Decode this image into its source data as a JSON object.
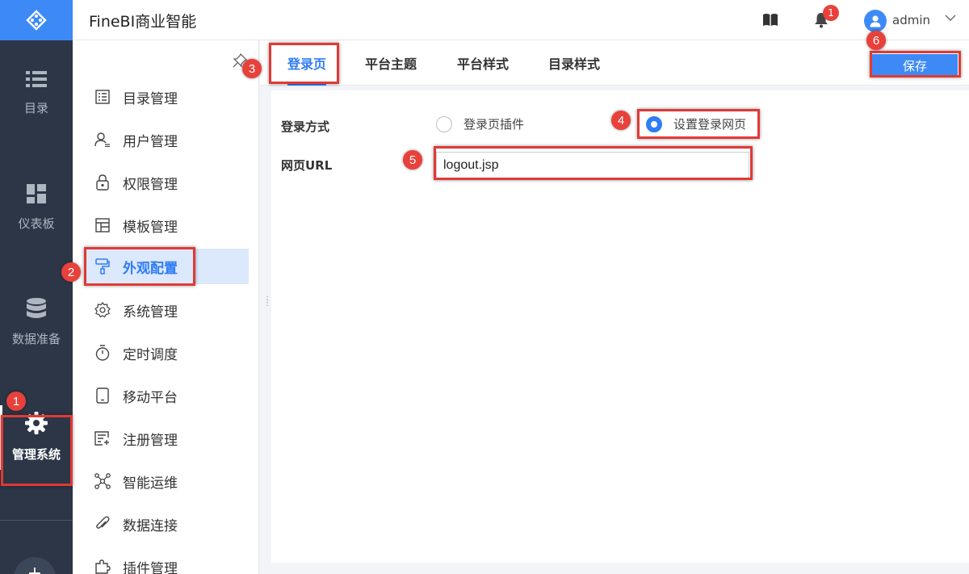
{
  "app": {
    "title": "FineBI商业智能"
  },
  "header": {
    "notification_count": "1",
    "username": "admin"
  },
  "rail": {
    "items": [
      {
        "label": "目录",
        "icon": "list-icon"
      },
      {
        "label": "仪表板",
        "icon": "dashboard-icon"
      },
      {
        "label": "数据准备",
        "icon": "database-icon"
      },
      {
        "label": "管理系统",
        "icon": "gear-icon",
        "active": true
      }
    ]
  },
  "menu": {
    "items": [
      {
        "label": "目录管理",
        "icon": "catalog-icon"
      },
      {
        "label": "用户管理",
        "icon": "user-icon"
      },
      {
        "label": "权限管理",
        "icon": "lock-icon"
      },
      {
        "label": "模板管理",
        "icon": "template-icon"
      },
      {
        "label": "外观配置",
        "icon": "paint-roller-icon",
        "active": true
      },
      {
        "label": "系统管理",
        "icon": "settings-icon"
      },
      {
        "label": "定时调度",
        "icon": "timer-icon"
      },
      {
        "label": "移动平台",
        "icon": "mobile-icon"
      },
      {
        "label": "注册管理",
        "icon": "register-icon"
      },
      {
        "label": "智能运维",
        "icon": "nodes-icon"
      },
      {
        "label": "数据连接",
        "icon": "link-icon"
      },
      {
        "label": "插件管理",
        "icon": "puzzle-icon"
      }
    ]
  },
  "tabs": [
    {
      "label": "登录页",
      "active": true
    },
    {
      "label": "平台主题"
    },
    {
      "label": "平台样式"
    },
    {
      "label": "目录样式"
    }
  ],
  "toolbar": {
    "save_label": "保存"
  },
  "form": {
    "login_method_label": "登录方式",
    "option_plugin": "登录页插件",
    "option_custom": "设置登录网页",
    "selected_option": "设置登录网页",
    "url_label": "网页URL",
    "url_value": "logout.jsp"
  },
  "annotations": [
    "1",
    "2",
    "3",
    "4",
    "5",
    "6"
  ],
  "colors": {
    "accent": "#2f7cf6",
    "rail_bg": "#2c3646",
    "highlight": "#e03a36"
  }
}
